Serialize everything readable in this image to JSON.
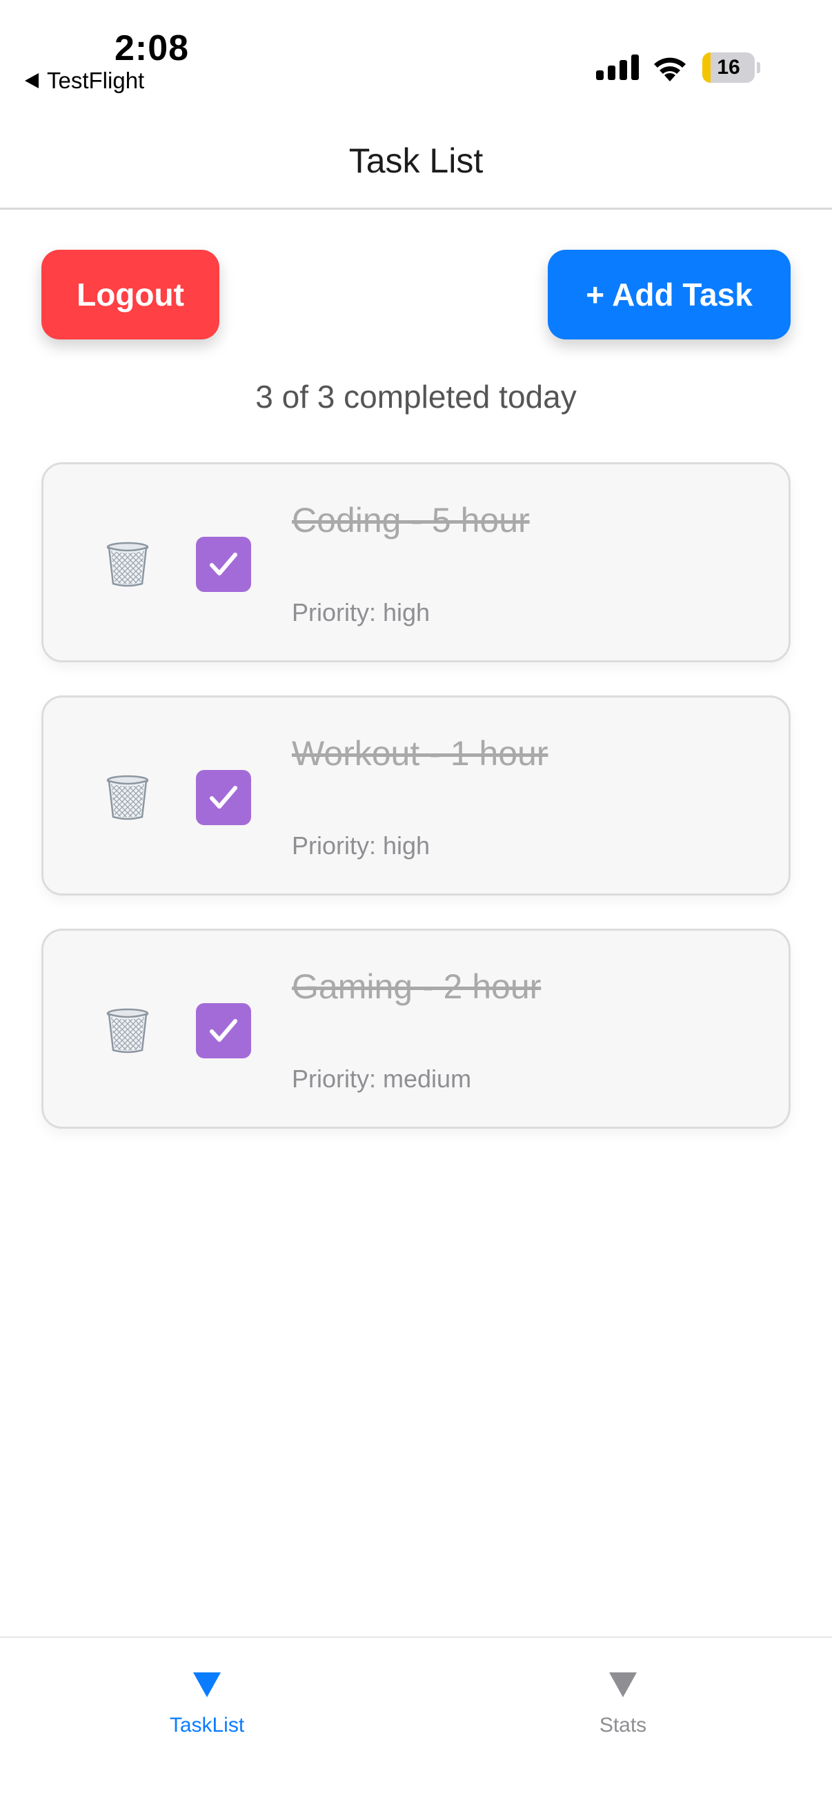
{
  "status_bar": {
    "time": "2:08",
    "back_app": "TestFlight",
    "battery_level": "16"
  },
  "header": {
    "title": "Task List"
  },
  "actions": {
    "logout_label": "Logout",
    "add_task_label": "+ Add Task"
  },
  "summary": "3 of 3 completed today",
  "tasks": [
    {
      "title": "Coding - 5 hour",
      "priority": "Priority: high",
      "completed": true
    },
    {
      "title": "Workout - 1 hour",
      "priority": "Priority: high",
      "completed": true
    },
    {
      "title": "Gaming - 2 hour",
      "priority": "Priority: medium",
      "completed": true
    }
  ],
  "tab_bar": {
    "tabs": [
      {
        "label": "TaskList",
        "icon": "triangle-down-icon",
        "active": true
      },
      {
        "label": "Stats",
        "icon": "triangle-down-icon",
        "active": false
      }
    ]
  },
  "colors": {
    "logout": "#ff4044",
    "primary": "#0a7cff",
    "checkbox": "#a36bd8",
    "battery_low": "#f5c400"
  }
}
